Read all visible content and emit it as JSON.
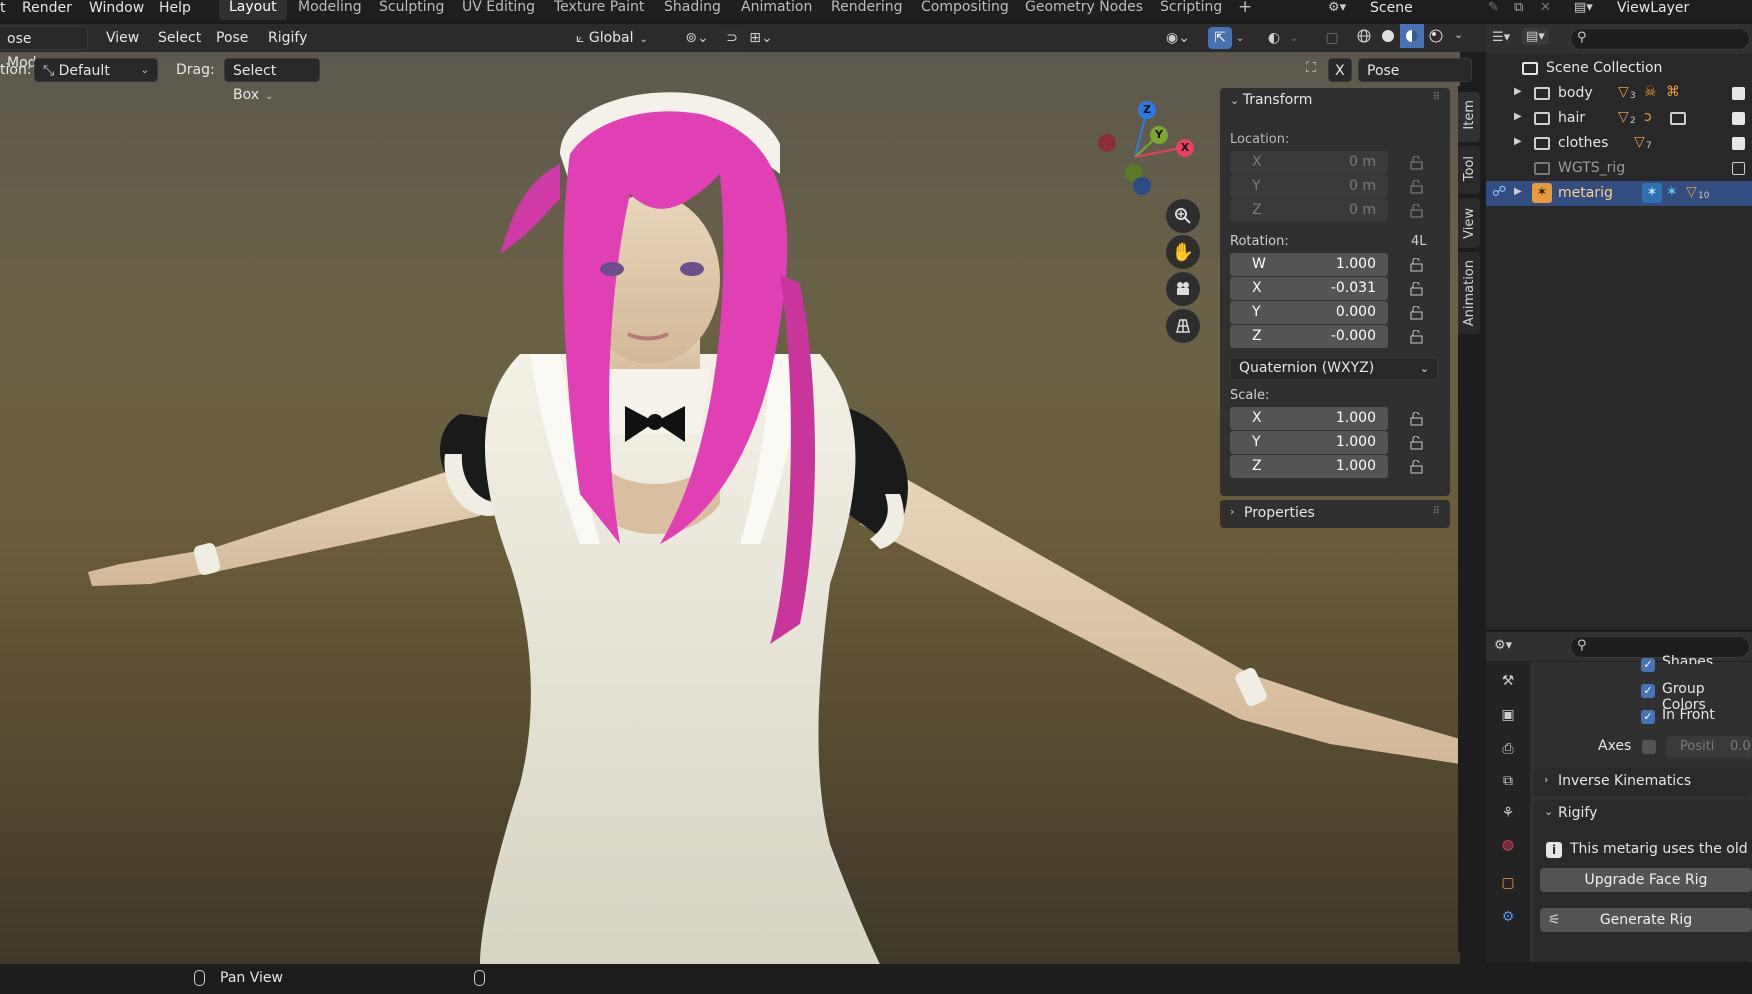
{
  "topmenu": {
    "items": [
      "t",
      "Render",
      "Window",
      "Help"
    ],
    "workspaces": [
      "Layout",
      "Modeling",
      "Sculpting",
      "UV Editing",
      "Texture Paint",
      "Shading",
      "Animation",
      "Rendering",
      "Compositing",
      "Geometry Nodes",
      "Scripting",
      "+"
    ],
    "active_workspace": "Layout",
    "scene_label": "Scene",
    "viewlayer_label": "ViewLayer"
  },
  "header": {
    "mode": "ose Mode",
    "menus": [
      "View",
      "Select",
      "Pose",
      "Rigify"
    ],
    "orientation": "Global"
  },
  "toolheader": {
    "orientation_label": "tion:",
    "orientation_value": "Default",
    "drag_label": "Drag:",
    "drag_value": "Select Box",
    "mirror_x": "X",
    "pose_options": "Pose Options"
  },
  "gizmo": {
    "z": "Z",
    "y": "Y",
    "x": "X"
  },
  "npanel": {
    "transform_title": "Transform",
    "location_label": "Location:",
    "location": [
      {
        "axis": "X",
        "value": "0 m"
      },
      {
        "axis": "Y",
        "value": "0 m"
      },
      {
        "axis": "Z",
        "value": "0 m"
      }
    ],
    "rotation_label": "Rotation:",
    "rotation_4l": "4L",
    "rotation": [
      {
        "axis": "W",
        "value": "1.000"
      },
      {
        "axis": "X",
        "value": "-0.031"
      },
      {
        "axis": "Y",
        "value": "0.000"
      },
      {
        "axis": "Z",
        "value": "-0.000"
      }
    ],
    "rotation_mode": "Quaternion (WXYZ)",
    "scale_label": "Scale:",
    "scale": [
      {
        "axis": "X",
        "value": "1.000"
      },
      {
        "axis": "Y",
        "value": "1.000"
      },
      {
        "axis": "Z",
        "value": "1.000"
      }
    ],
    "properties_title": "Properties",
    "tabs": [
      "Item",
      "Tool",
      "View",
      "Animation"
    ]
  },
  "outliner": {
    "root": "Scene Collection",
    "rows": [
      {
        "name": "body",
        "badge": "3"
      },
      {
        "name": "hair",
        "badge": "2"
      },
      {
        "name": "clothes",
        "badge": "7"
      },
      {
        "name": "WGTS_rig",
        "badge": ""
      },
      {
        "name": "metarig",
        "badge": "10"
      }
    ]
  },
  "properties": {
    "shapes_label": "Shapes",
    "group_colors": "Group Colors",
    "in_front": "In Front",
    "axes_label": "Axes",
    "axes_position": "Positi",
    "axes_value": "0.0",
    "ik_title": "Inverse Kinematics",
    "rigify_title": "Rigify",
    "rigify_info": "This metarig uses the old fa",
    "upgrade_button": "Upgrade Face Rig",
    "generate_button": "Generate Rig"
  },
  "status": {
    "hint": "Pan View"
  },
  "colors": {
    "accent": "#4772b3",
    "selection": "#334d80",
    "hair": "#e040b4",
    "axis_x": "#e84060",
    "axis_y": "#78a82c",
    "axis_z": "#2e7ae0"
  }
}
